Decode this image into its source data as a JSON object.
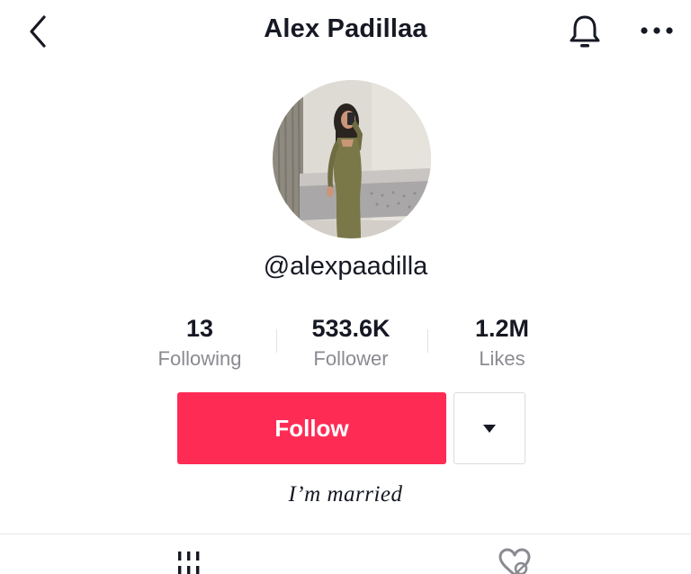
{
  "header": {
    "title": "Alex Padillaa",
    "back_icon": "chevron-left-icon",
    "bell_icon": "bell-icon",
    "more_icon": "more-horizontal-icon"
  },
  "profile": {
    "username": "@alexpaadilla",
    "bio": "I’m married"
  },
  "stats": [
    {
      "value": "13",
      "label": "Following"
    },
    {
      "value": "533.6K",
      "label": "Follower"
    },
    {
      "value": "1.2M",
      "label": "Likes"
    }
  ],
  "actions": {
    "follow_label": "Follow",
    "dropdown_icon": "caret-down-icon"
  },
  "tabs": [
    {
      "icon": "grid-icon"
    },
    {
      "icon": "liked-heart-icon"
    }
  ],
  "colors": {
    "accent": "#fe2c55",
    "text": "#161823",
    "secondary_text": "#8a8b91"
  }
}
